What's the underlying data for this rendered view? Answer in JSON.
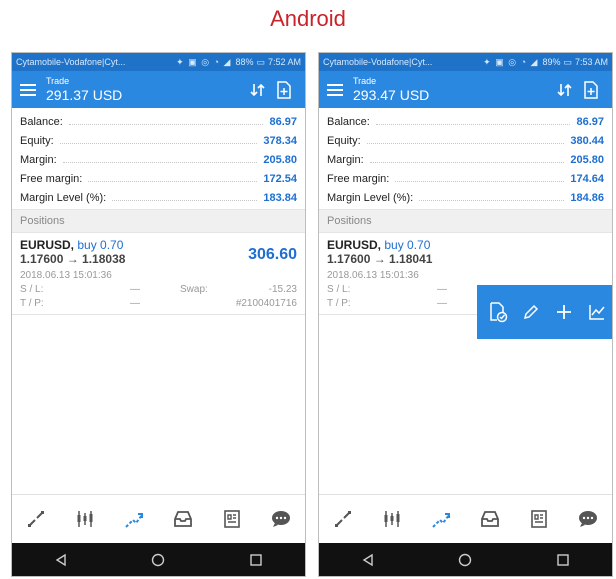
{
  "heading": "Android",
  "colors": {
    "accent": "#2b88e0",
    "value_blue": "#1e6fd0",
    "heading_red": "#c8242a"
  },
  "phones": [
    {
      "status": {
        "carrier": "Cytamobile-Vodafone|Cyt...",
        "battery": "88%",
        "time": "7:52 AM"
      },
      "appbar": {
        "title": "Trade",
        "balance": "291.37 USD"
      },
      "summary": [
        {
          "label": "Balance:",
          "value": "86.97"
        },
        {
          "label": "Equity:",
          "value": "378.34"
        },
        {
          "label": "Margin:",
          "value": "205.80"
        },
        {
          "label": "Free margin:",
          "value": "172.54"
        },
        {
          "label": "Margin Level (%):",
          "value": "183.84"
        }
      ],
      "positions_header": "Positions",
      "position": {
        "symbol": "EURUSD,",
        "direction": "buy 0.70",
        "prices": "1.17600 → 1.18038",
        "profit": "306.60",
        "datetime": "2018.06.13 15:01:36",
        "sl_label": "S / L:",
        "sl_value": "—",
        "swap_label": "Swap:",
        "swap_value": "-15.23",
        "tp_label": "T / P:",
        "tp_value": "—",
        "order": "#2100401716"
      }
    },
    {
      "status": {
        "carrier": "Cytamobile-Vodafone|Cyt...",
        "battery": "89%",
        "time": "7:53 AM"
      },
      "appbar": {
        "title": "Trade",
        "balance": "293.47 USD"
      },
      "summary": [
        {
          "label": "Balance:",
          "value": "86.97"
        },
        {
          "label": "Equity:",
          "value": "380.44"
        },
        {
          "label": "Margin:",
          "value": "205.80"
        },
        {
          "label": "Free margin:",
          "value": "174.64"
        },
        {
          "label": "Margin Level (%):",
          "value": "184.86"
        }
      ],
      "positions_header": "Positions",
      "position": {
        "symbol": "EURUSD,",
        "direction": "buy 0.70",
        "prices": "1.17600 → 1.18041",
        "datetime": "2018.06.13 15:01:36",
        "sl_label": "S / L:",
        "sl_value": "—",
        "tp_label": "T / P:",
        "tp_value": "—"
      }
    }
  ]
}
